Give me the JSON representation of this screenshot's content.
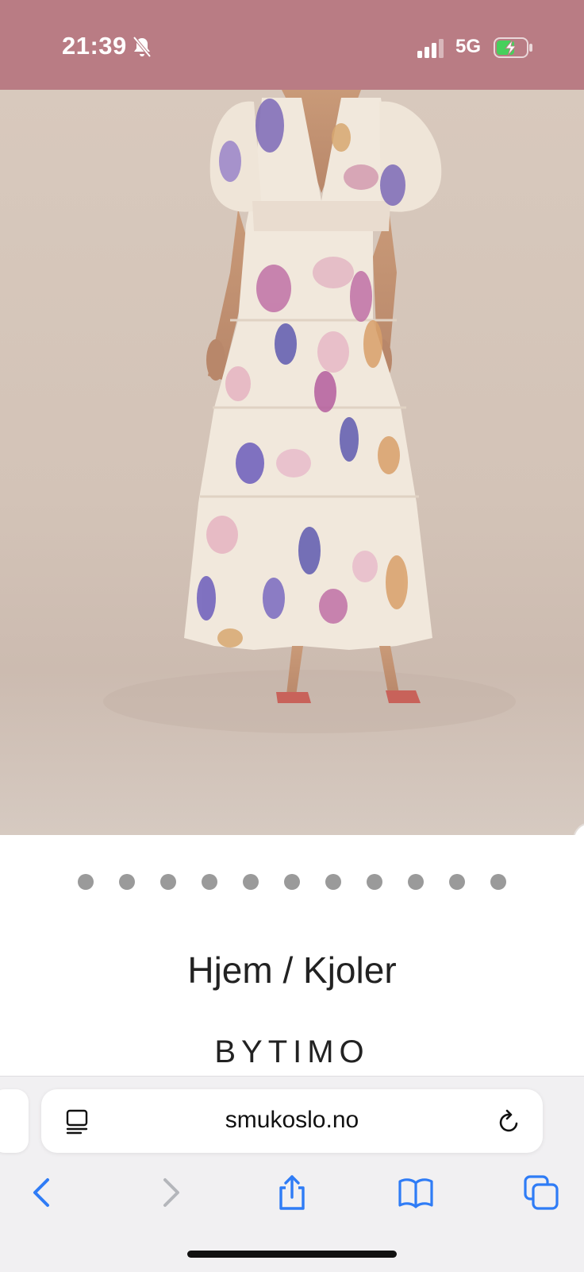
{
  "status_bar": {
    "time": "21:39",
    "network": "5G",
    "icons": [
      "bell-slash-icon",
      "signal-icon",
      "battery-charging-icon"
    ],
    "background_color": "#b97c84"
  },
  "product_gallery": {
    "image_alt": "floral tiered maxi dress with puff sleeves",
    "dots_count": 11
  },
  "product": {
    "breadcrumb": "Hjem / Kjoler",
    "brand": "BYTIMO"
  },
  "browser": {
    "url": "smukoslo.no",
    "icons": [
      "reader-mode-icon",
      "reload-icon",
      "back-icon",
      "forward-icon",
      "share-icon",
      "bookmarks-icon",
      "tabs-icon"
    ],
    "accent_color": "#2f7cf6"
  }
}
